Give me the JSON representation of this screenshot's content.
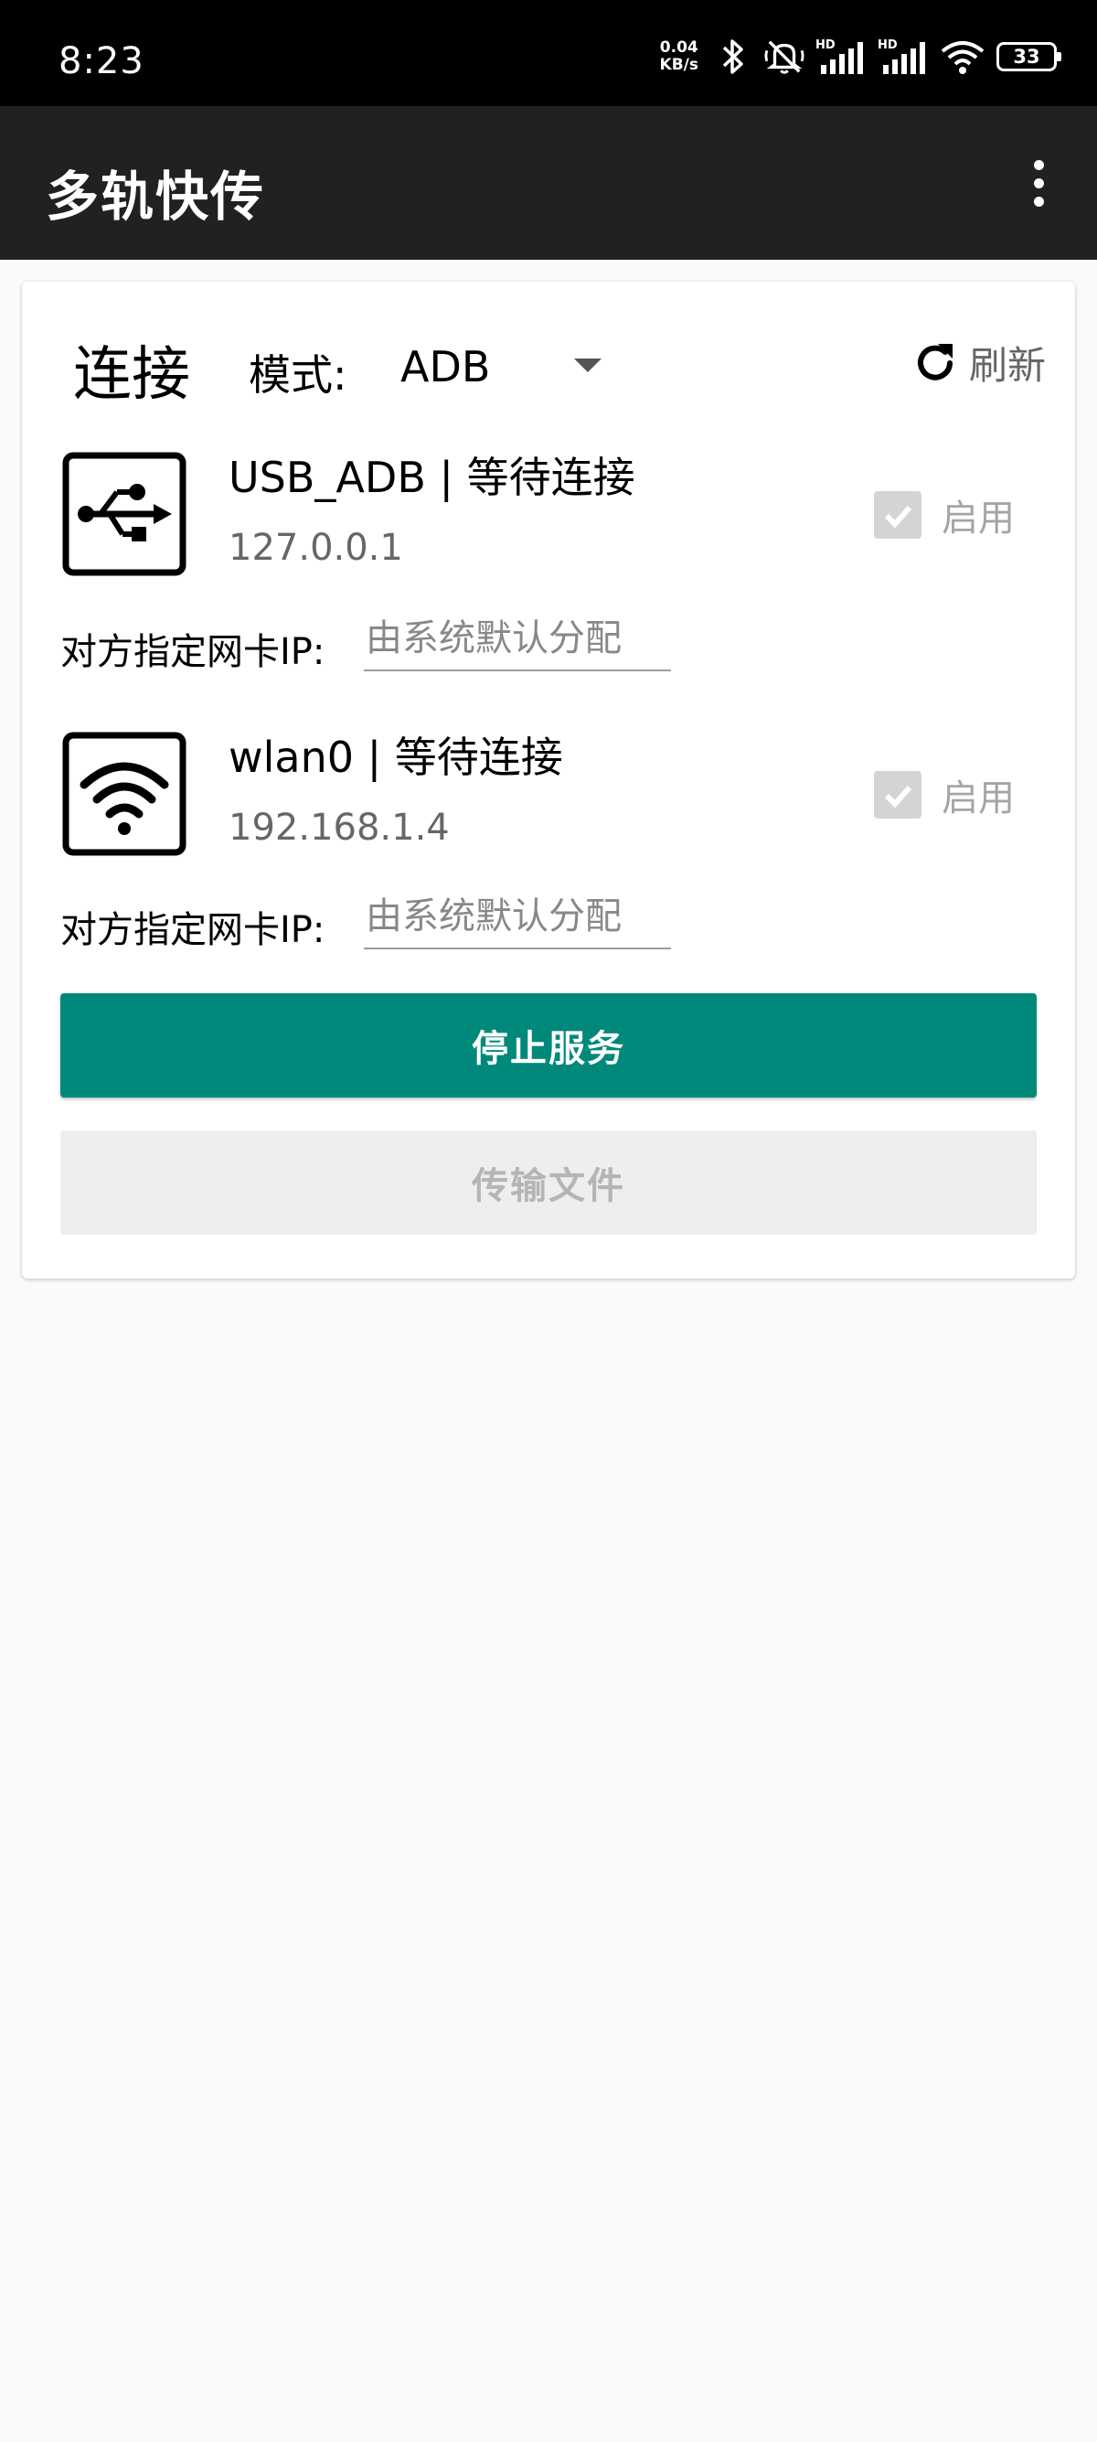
{
  "status_bar": {
    "time": "8:23",
    "net_speed_value": "0.04",
    "net_speed_unit": "KB/s",
    "hd1": "HD",
    "hd2": "HD",
    "battery": "33",
    "icons": [
      "bluetooth-icon",
      "silent-icon",
      "signal-icon",
      "signal-icon",
      "wifi-icon",
      "battery-icon"
    ]
  },
  "appbar": {
    "title": "多轨快传",
    "menu_icon": "more-vert-icon"
  },
  "connection": {
    "title": "连接",
    "mode_label": "模式:",
    "mode_value": "ADB",
    "refresh_label": "刷新",
    "interfaces": [
      {
        "icon": "usb-icon",
        "name": "USB_ADB | 等待连接",
        "ip": "127.0.0.1",
        "enable_label": "启用",
        "enabled": true,
        "peer_label": "对方指定网卡IP:",
        "peer_placeholder": "由系统默认分配"
      },
      {
        "icon": "wifi-icon",
        "name": "wlan0 | 等待连接",
        "ip": "192.168.1.4",
        "enable_label": "启用",
        "enabled": true,
        "peer_label": "对方指定网卡IP:",
        "peer_placeholder": "由系统默认分配"
      }
    ],
    "stop_button": "停止服务",
    "transfer_button": "传输文件"
  },
  "colors": {
    "accent": "#00897b",
    "appbar": "#212121",
    "background": "#fafafa"
  }
}
